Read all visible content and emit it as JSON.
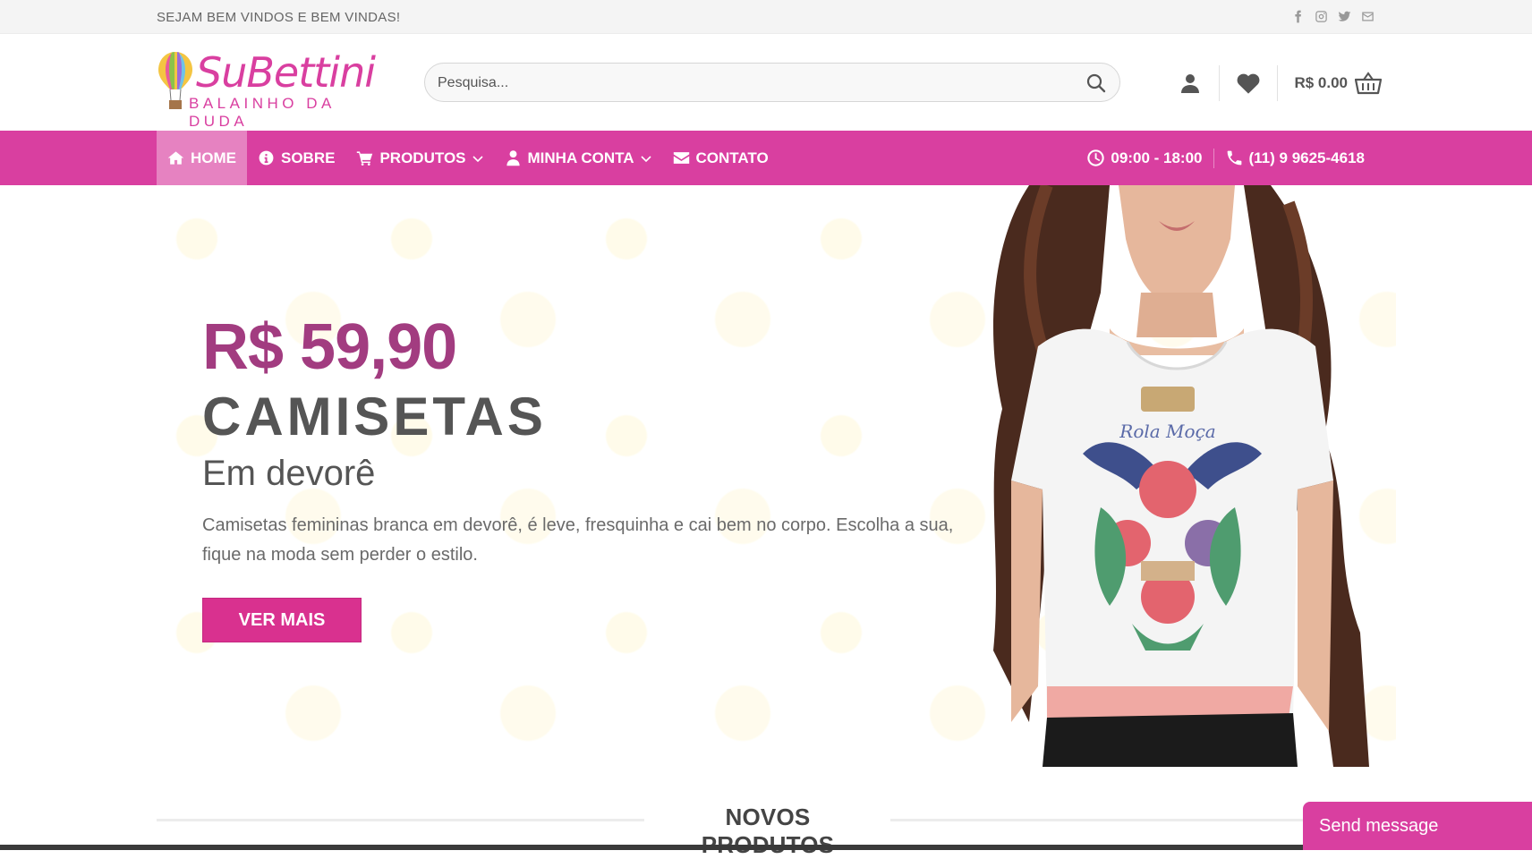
{
  "topbar": {
    "welcome": "SEJAM BEM VINDOS E BEM VINDAS!",
    "social": [
      "facebook-icon",
      "instagram-icon",
      "twitter-icon",
      "mail-icon"
    ]
  },
  "header": {
    "brand": "SuBettini",
    "tagline": "BALAINHO DA DUDA",
    "search_placeholder": "Pesquisa...",
    "cart_amount": "R$ 0.00"
  },
  "nav": {
    "items": [
      {
        "label": "HOME",
        "icon": "home-icon",
        "active": true
      },
      {
        "label": "SOBRE",
        "icon": "info-icon"
      },
      {
        "label": "PRODUTOS",
        "icon": "cart-icon",
        "dropdown": true
      },
      {
        "label": "MINHA CONTA",
        "icon": "user-icon",
        "dropdown": true
      },
      {
        "label": "CONTATO",
        "icon": "envelope-icon"
      }
    ],
    "hours": "09:00 - 18:00",
    "phone": "(11) 9 9625-4618"
  },
  "hero": {
    "price": "R$ 59,90",
    "title": "CAMISETAS",
    "subtitle": "Em devorê",
    "description": "Camisetas femininas branca em devorê, é leve, fresquinha e cai bem no corpo. Escolha a sua, fique na moda sem perder o estilo.",
    "cta": "VER MAIS"
  },
  "section": {
    "title": "NOVOS PRODUTOS"
  },
  "chat": {
    "label": "Send message"
  },
  "colors": {
    "accent": "#d93fa0",
    "price": "#a23c80",
    "button": "#d9318f"
  }
}
